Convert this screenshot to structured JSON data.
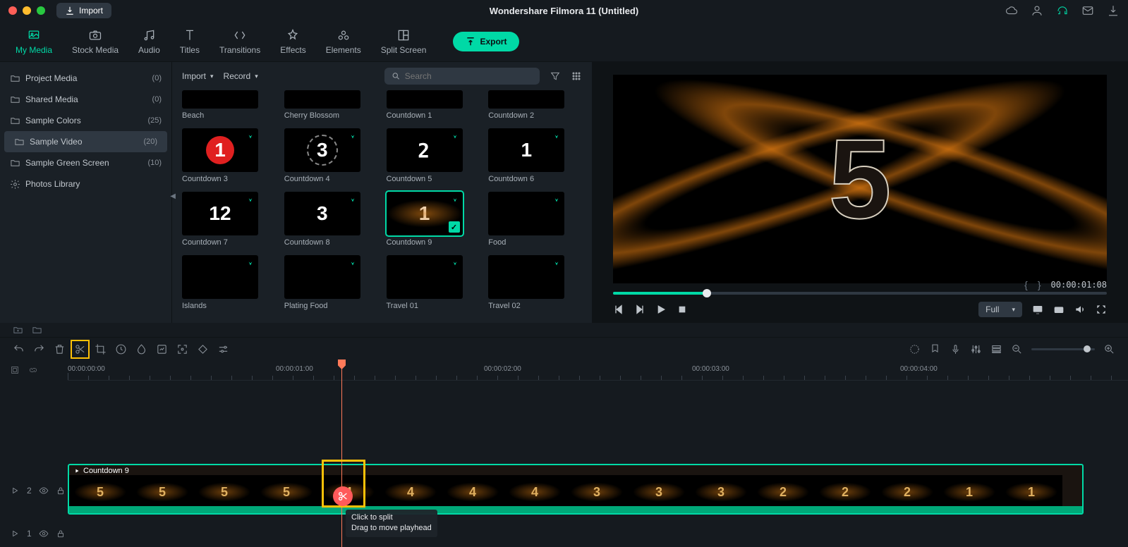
{
  "app": {
    "title": "Wondershare Filmora 11 (Untitled)",
    "import_btn": "Import",
    "export_btn": "Export"
  },
  "tabs": [
    {
      "label": "My Media",
      "active": true
    },
    {
      "label": "Stock Media"
    },
    {
      "label": "Audio"
    },
    {
      "label": "Titles"
    },
    {
      "label": "Transitions"
    },
    {
      "label": "Effects"
    },
    {
      "label": "Elements"
    },
    {
      "label": "Split Screen"
    }
  ],
  "sidebar": {
    "items": [
      {
        "label": "Project Media",
        "count": "(0)"
      },
      {
        "label": "Shared Media",
        "count": "(0)"
      },
      {
        "label": "Sample Colors",
        "count": "(25)"
      },
      {
        "label": "Sample Video",
        "count": "(20)",
        "selected": true
      },
      {
        "label": "Sample Green Screen",
        "count": "(10)"
      },
      {
        "label": "Photos Library",
        "count": ""
      }
    ]
  },
  "media_bar": {
    "import": "Import",
    "record": "Record",
    "search_placeholder": "Search"
  },
  "media": [
    {
      "label": "Beach",
      "cls": "bg-beach",
      "half": true
    },
    {
      "label": "Cherry Blossom",
      "cls": "bg-cherry",
      "half": true
    },
    {
      "label": "Countdown 1",
      "cls": "bg-c1",
      "half": true
    },
    {
      "label": "Countdown 2",
      "cls": "bg-c2",
      "half": true
    },
    {
      "label": "Countdown 3",
      "cls": "bg-c3",
      "num": "1",
      "dl": true
    },
    {
      "label": "Countdown 4",
      "cls": "bg-c4",
      "num": "3",
      "dl": true
    },
    {
      "label": "Countdown 5",
      "cls": "bg-c5",
      "num": "2",
      "dl": true
    },
    {
      "label": "Countdown 6",
      "cls": "bg-c6",
      "num": "1",
      "dl": true
    },
    {
      "label": "Countdown 7",
      "cls": "bg-c7",
      "num": "12",
      "dl": true
    },
    {
      "label": "Countdown 8",
      "cls": "bg-c8",
      "num": "3",
      "dl": true
    },
    {
      "label": "Countdown 9",
      "cls": "bg-c9",
      "num": "1",
      "dl": true,
      "selected": true,
      "checked": true
    },
    {
      "label": "Food",
      "cls": "bg-food",
      "dl": true
    },
    {
      "label": "Islands",
      "cls": "bg-islands",
      "dl": true
    },
    {
      "label": "Plating Food",
      "cls": "bg-plating",
      "dl": true
    },
    {
      "label": "Travel 01",
      "cls": "bg-travel1",
      "dl": true
    },
    {
      "label": "Travel 02",
      "cls": "bg-travel2",
      "dl": true
    }
  ],
  "preview": {
    "digit": "5",
    "timecode": "00:00:01:08",
    "quality": "Full"
  },
  "ruler": {
    "marks": [
      "00:00:00:00",
      "00:00:01:00",
      "00:00:02:00",
      "00:00:03:00",
      "00:00:04:00"
    ]
  },
  "timeline": {
    "clip_name": "Countdown 9",
    "frames": [
      "5",
      "5",
      "5",
      "5",
      "4",
      "4",
      "4",
      "4",
      "3",
      "3",
      "3",
      "2",
      "2",
      "2",
      "1",
      "1"
    ],
    "tracks": [
      {
        "label": "2"
      },
      {
        "label": "1"
      }
    ],
    "tooltip": {
      "line1": "Click to split",
      "line2": "Drag to move playhead"
    }
  }
}
